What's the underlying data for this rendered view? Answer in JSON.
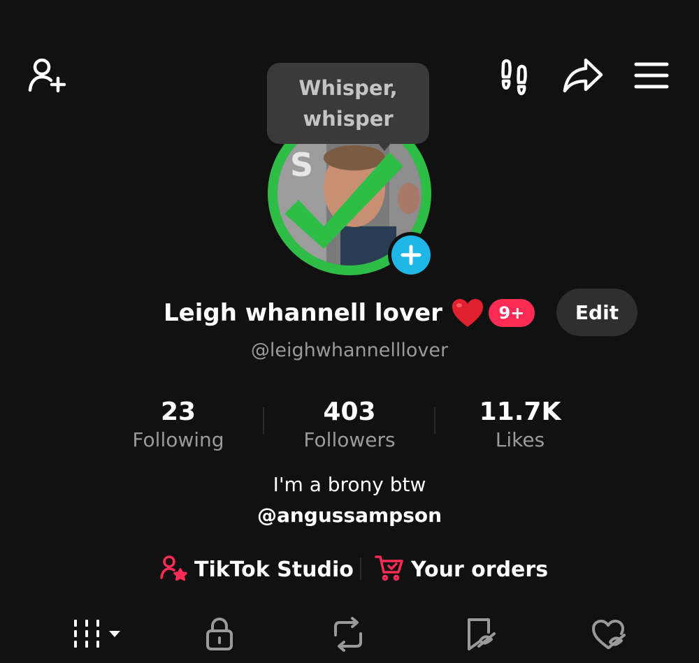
{
  "header": {
    "icons": [
      "add-friend-icon",
      "footprints-icon",
      "share-icon",
      "menu-icon"
    ]
  },
  "tooltip": {
    "text": "Whisper, whisper"
  },
  "profile": {
    "display_name": "Leigh whannell lover",
    "notification_badge": "9+",
    "edit_label": "Edit",
    "username": "@leighwhannelllover",
    "avatar_ring_color": "#2ebd47",
    "add_badge_color": "#1fb7e6"
  },
  "stats": [
    {
      "value": "23",
      "label": "Following"
    },
    {
      "value": "403",
      "label": "Followers"
    },
    {
      "value": "11.7K",
      "label": "Likes"
    }
  ],
  "bio": {
    "text": "I'm a brony btw",
    "mention": "@angussampson"
  },
  "links": [
    {
      "label": "TikTok Studio",
      "icon": "creator-star-icon"
    },
    {
      "label": "Your orders",
      "icon": "cart-icon"
    }
  ],
  "tabs": [
    {
      "icon": "videos-grid-icon",
      "active": true
    },
    {
      "icon": "lock-icon",
      "active": false
    },
    {
      "icon": "repost-icon",
      "active": false
    },
    {
      "icon": "favorites-icon",
      "active": false
    },
    {
      "icon": "liked-icon",
      "active": false
    }
  ],
  "colors": {
    "background": "#111111",
    "accent_red": "#fe2c55",
    "muted_text": "#9a9a9a"
  }
}
